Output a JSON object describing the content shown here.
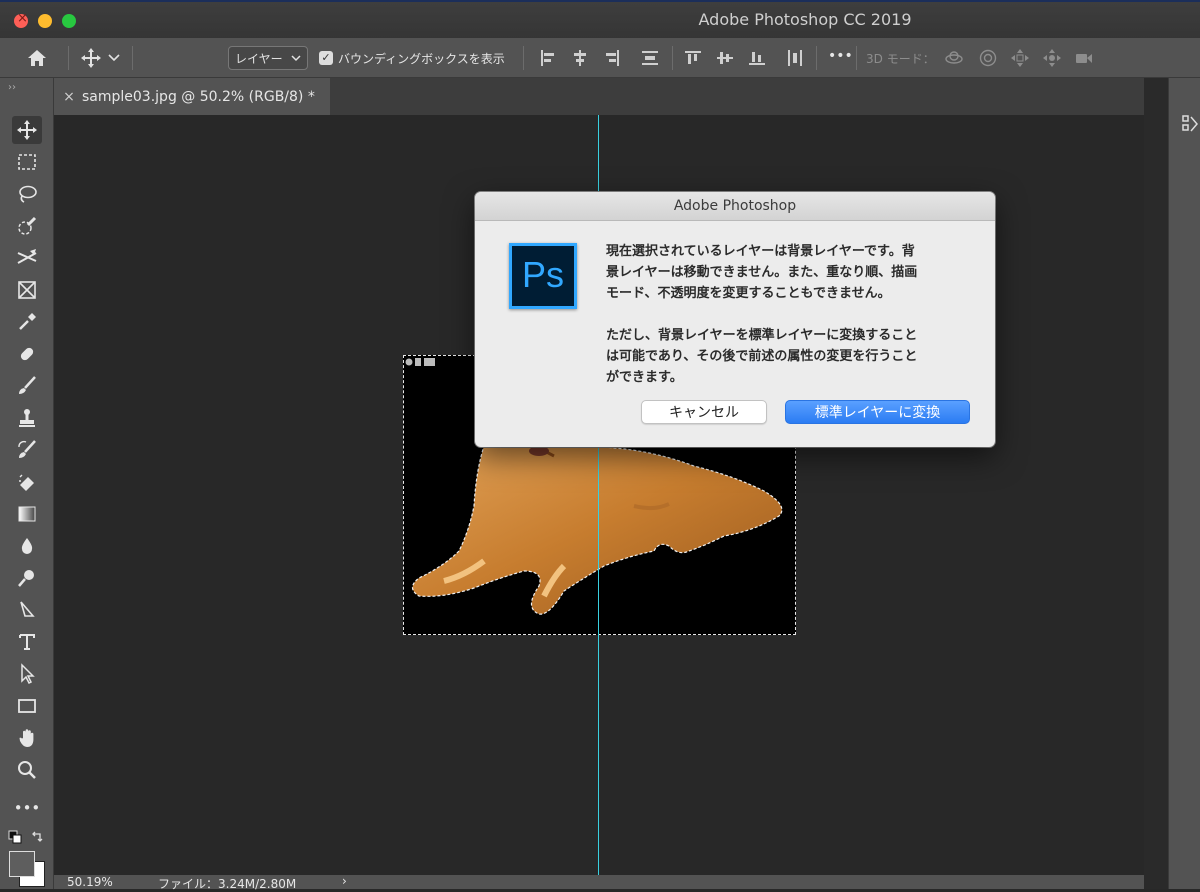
{
  "window": {
    "title": "Adobe Photoshop CC 2019"
  },
  "options_bar": {
    "layer_select": "レイヤー",
    "bounding_box_label": "バウンディングボックスを表示",
    "bounding_box_checked": true,
    "more": "•••",
    "mode_3d_label": "3D モード："
  },
  "document_tab": {
    "close": "×",
    "label": "sample03.jpg @ 50.2% (RGB/8) *"
  },
  "toolbar": {
    "more": "•••"
  },
  "status": {
    "zoom": "50.19%",
    "file": "ファイル：3.24M/2.80M",
    "arrow": "›"
  },
  "dialog": {
    "title": "Adobe Photoshop",
    "logo_text": "Ps",
    "message_lines_1": [
      "現在選択されているレイヤーは背景レイヤーです。背",
      "景レイヤーは移動できません。また、重なり順、描画",
      "モード、不透明度を変更することもできません。"
    ],
    "message_lines_2": [
      "ただし、背景レイヤーを標準レイヤーに変換すること",
      "は可能であり、その後で前述の属性の変更を行うこと",
      "ができます。"
    ],
    "cancel_label": "キャンセル",
    "convert_label": "標準レイヤーに変換"
  },
  "colors": {
    "guide": "#39d0e0",
    "accent_button": "#2b7cf3",
    "ps_logo_blue": "#31a8ff"
  },
  "icons": [
    "home-icon",
    "move-icon",
    "chevron-down-icon",
    "checkbox-icon",
    "align-left-icon",
    "align-hcenter-icon",
    "align-right-icon",
    "distribute-icon",
    "align-top-icon",
    "align-vcenter-icon",
    "align-bottom-icon",
    "distribute-vertical-icon",
    "orbit-3d-icon",
    "roll-3d-icon",
    "drag-3d-icon",
    "slide-3d-icon",
    "scale-3d-icon"
  ]
}
